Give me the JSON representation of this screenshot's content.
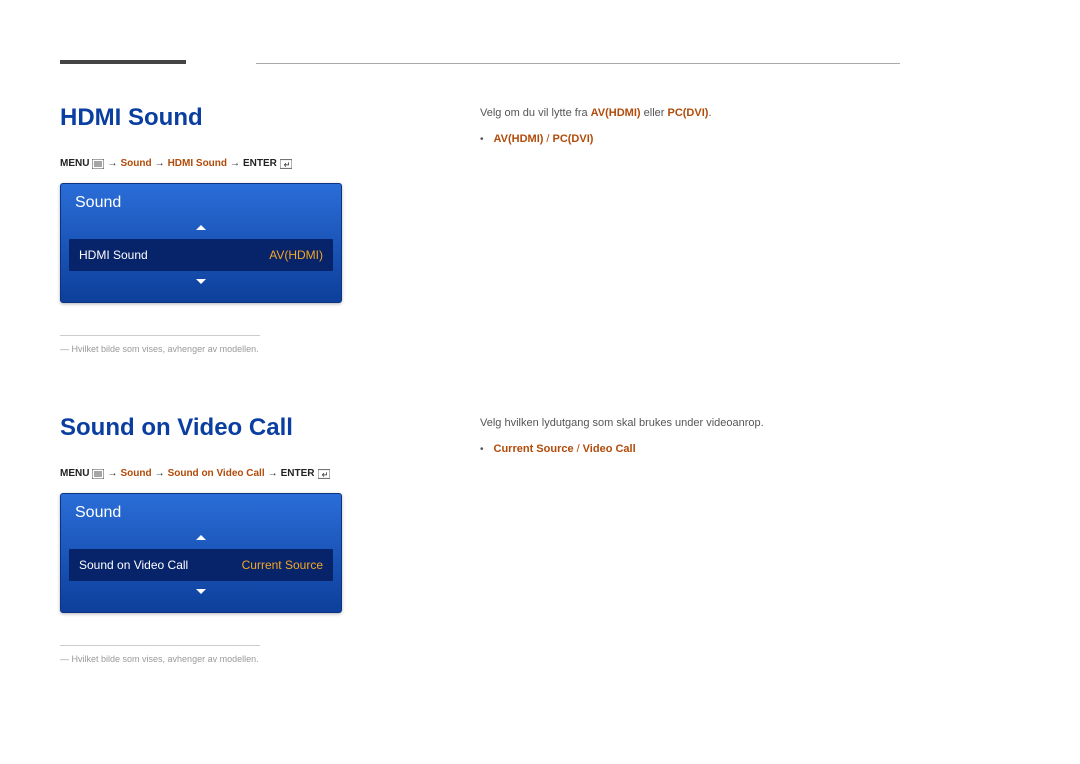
{
  "section1": {
    "heading": "HDMI Sound",
    "path_prefix": "MENU",
    "path_crumbs": [
      "Sound",
      "HDMI Sound"
    ],
    "path_suffix": "ENTER",
    "ui": {
      "title": "Sound",
      "item_label": "HDMI Sound",
      "item_value": "AV(HDMI)"
    },
    "footnote": "Hvilket bilde som vises, avhenger av modellen.",
    "desc_pre": "Velg om du vil lytte fra ",
    "desc_em1": "AV(HDMI)",
    "desc_mid": " eller ",
    "desc_em2": "PC(DVI)",
    "desc_end": ".",
    "opt1": "AV(HDMI)",
    "opt2": "PC(DVI)"
  },
  "section2": {
    "heading": "Sound on Video Call",
    "path_prefix": "MENU",
    "path_crumbs": [
      "Sound",
      "Sound on Video Call"
    ],
    "path_suffix": "ENTER",
    "ui": {
      "title": "Sound",
      "item_label": "Sound on Video Call",
      "item_value": "Current Source"
    },
    "footnote": "Hvilket bilde som vises, avhenger av modellen.",
    "desc": "Velg hvilken lydutgang som skal brukes under videoanrop.",
    "opt1": "Current Source",
    "opt2": "Video Call"
  }
}
